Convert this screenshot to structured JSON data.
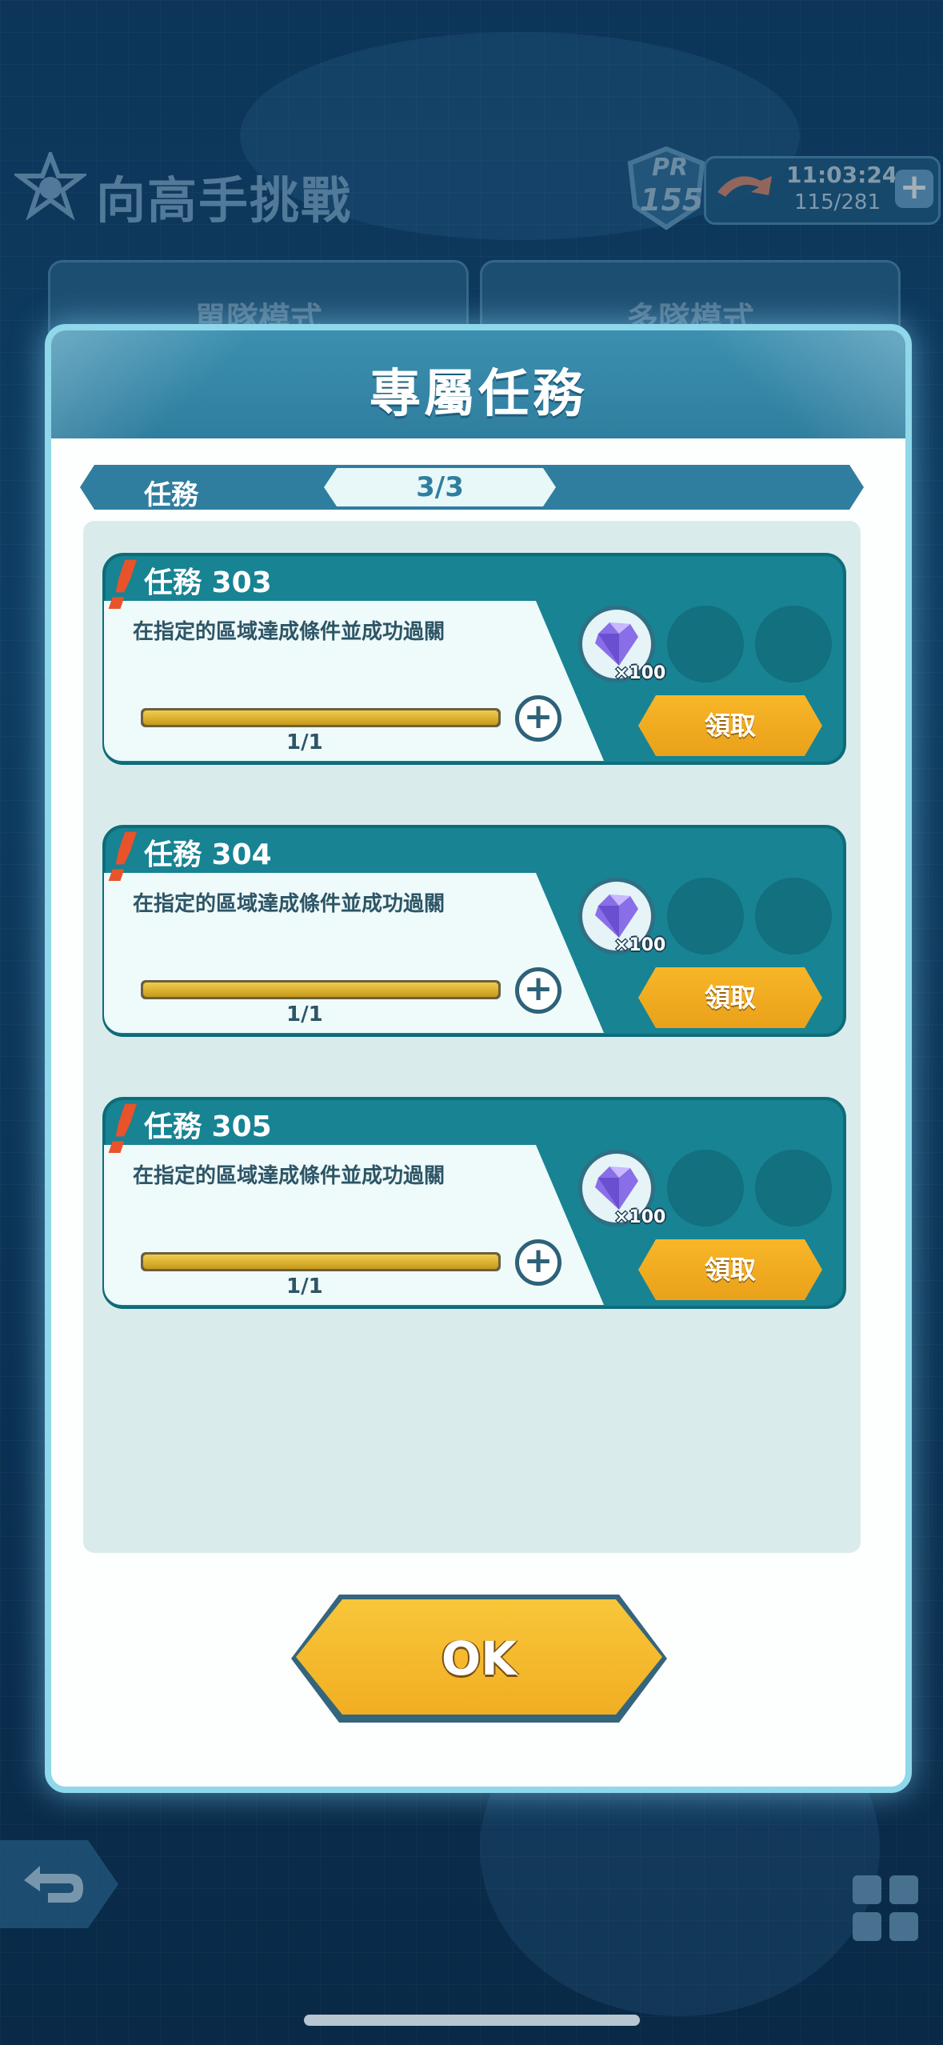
{
  "background": {
    "title": "向高手挑戰",
    "pr_label": "PR",
    "pr_value": "155",
    "stamina": {
      "time": "11:03:24",
      "count": "115/281"
    },
    "mode_tabs": [
      "單隊模式",
      "多隊模式"
    ]
  },
  "modal": {
    "title": "專屬任務",
    "tab_label": "任務",
    "tab_count": "3/3",
    "missions": [
      {
        "name": "任務 303",
        "description": "在指定的區域達成條件並成功過關",
        "progress_text": "1/1",
        "progress": 1.0,
        "reward_qty": "×100",
        "claim_label": "領取"
      },
      {
        "name": "任務 304",
        "description": "在指定的區域達成條件並成功過關",
        "progress_text": "1/1",
        "progress": 1.0,
        "reward_qty": "×100",
        "claim_label": "領取"
      },
      {
        "name": "任務 305",
        "description": "在指定的區域達成條件並成功過關",
        "progress_text": "1/1",
        "progress": 1.0,
        "reward_qty": "×100",
        "claim_label": "領取"
      }
    ],
    "ok_label": "OK"
  },
  "colors": {
    "accent_teal": "#178393",
    "claim_orange": "#f2ae22",
    "exclamation": "#e8532b"
  },
  "icons": {
    "header_emblem": "star-emblem-icon",
    "reward": "crystal-icon",
    "add": "plus-circle-icon",
    "back": "back-arrow-icon",
    "menu": "grid-icon"
  }
}
